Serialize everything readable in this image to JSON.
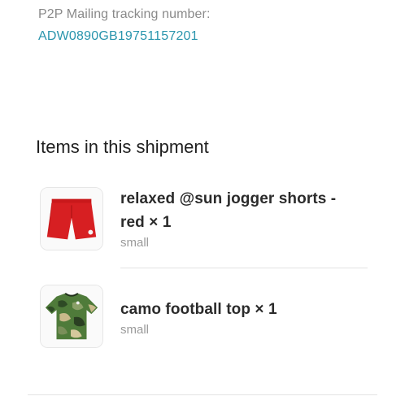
{
  "tracking": {
    "label": "P2P Mailing tracking number:",
    "number": "ADW0890GB19751157201"
  },
  "shipment": {
    "heading": "Items in this shipment",
    "items": [
      {
        "title": "relaxed @sun jogger shorts - red × 1",
        "size": "small",
        "thumbnail": "red-shorts-image"
      },
      {
        "title": "camo football top × 1",
        "size": "small",
        "thumbnail": "camo-top-image"
      }
    ]
  },
  "colors": {
    "link": "#2a95ad",
    "muted": "#8a8a8a"
  }
}
